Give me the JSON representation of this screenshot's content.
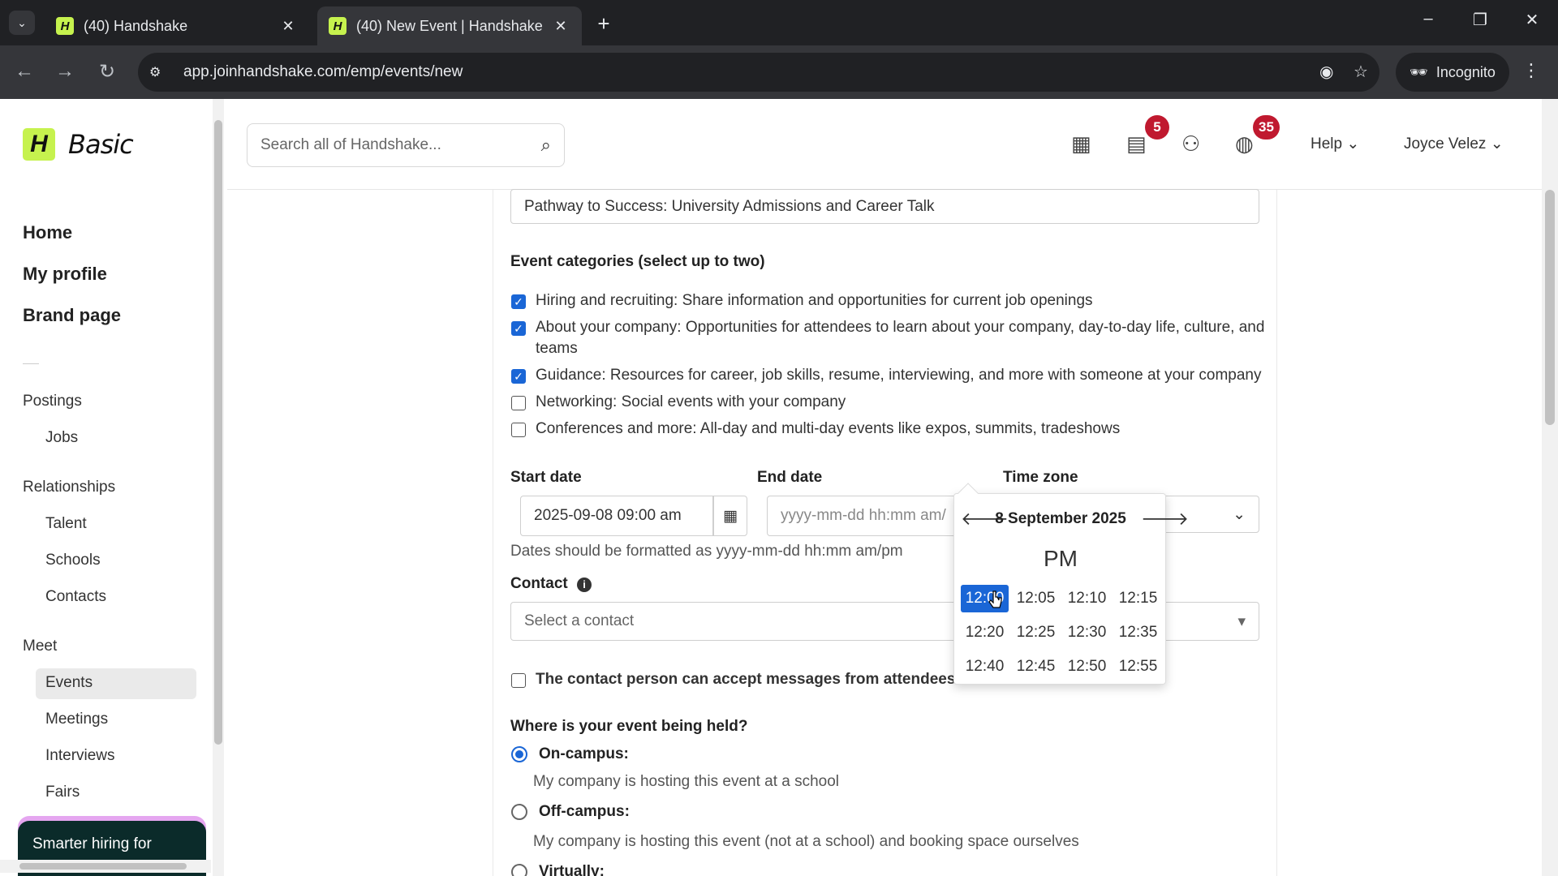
{
  "browser": {
    "tabs": [
      {
        "title": "(40) Handshake",
        "favicon": "H"
      },
      {
        "title": "(40) New Event | Handshake",
        "favicon": "H"
      }
    ],
    "url": "app.joinhandshake.com/emp/events/new",
    "incognito_label": "Incognito"
  },
  "sidebar": {
    "logo_mark": "H",
    "logo_text": "Basic",
    "main_links": [
      "Home",
      "My profile",
      "Brand page"
    ],
    "postings": {
      "title": "Postings",
      "items": [
        "Jobs"
      ]
    },
    "relationships": {
      "title": "Relationships",
      "items": [
        "Talent",
        "Schools",
        "Contacts"
      ]
    },
    "meet": {
      "title": "Meet",
      "items": [
        "Events",
        "Meetings",
        "Interviews",
        "Fairs"
      ],
      "active": "Events"
    },
    "promo": "Smarter hiring for"
  },
  "header": {
    "search_placeholder": "Search all of Handshake...",
    "messages_badge": "5",
    "notifications_badge": "35",
    "help": "Help",
    "user": "Joyce Velez"
  },
  "form": {
    "event_name_value": "Pathway to Success: University Admissions and Career Talk",
    "categories_label": "Event categories (select up to two)",
    "categories": [
      {
        "text": "Hiring and recruiting: Share information and opportunities for current job openings",
        "checked": true
      },
      {
        "text": "About your company: Opportunities for attendees to learn about your company, day-to-day life, culture, and teams",
        "checked": true
      },
      {
        "text": "Guidance: Resources for career, job skills, resume, interviewing, and more with someone at your company",
        "checked": true
      },
      {
        "text": "Networking: Social events with your company",
        "checked": false
      },
      {
        "text": "Conferences and more: All-day and multi-day events like expos, summits, tradeshows",
        "checked": false
      }
    ],
    "start_date_label": "Start date",
    "start_date_value": "2025-09-08 09:00 am",
    "end_date_label": "End date",
    "end_date_placeholder": "yyyy-mm-dd hh:mm am/",
    "time_zone_label": "Time zone",
    "date_hint": "Dates should be formatted as yyyy-mm-dd hh:mm am/pm",
    "contact_label": "Contact",
    "contact_placeholder": "Select a contact",
    "contact_messages_label": "The contact person can accept messages from attendees",
    "where_label": "Where is your event being held?",
    "locations": [
      {
        "label": "On-campus:",
        "desc": "My company is hosting this event at a school",
        "selected": true
      },
      {
        "label": "Off-campus:",
        "desc": "My company is hosting this event (not at a school) and booking space ourselves",
        "selected": false
      },
      {
        "label": "Virtually:",
        "desc": "",
        "selected": false
      }
    ]
  },
  "time_picker": {
    "title": "8 September 2025",
    "period": "PM",
    "times": [
      "12:00",
      "12:05",
      "12:10",
      "12:15",
      "12:20",
      "12:25",
      "12:30",
      "12:35",
      "12:40",
      "12:45",
      "12:50",
      "12:55"
    ],
    "selected": "12:00"
  },
  "colors": {
    "brand": "#c6f24e",
    "accent": "#1a66d6",
    "badge": "#c0192f"
  }
}
